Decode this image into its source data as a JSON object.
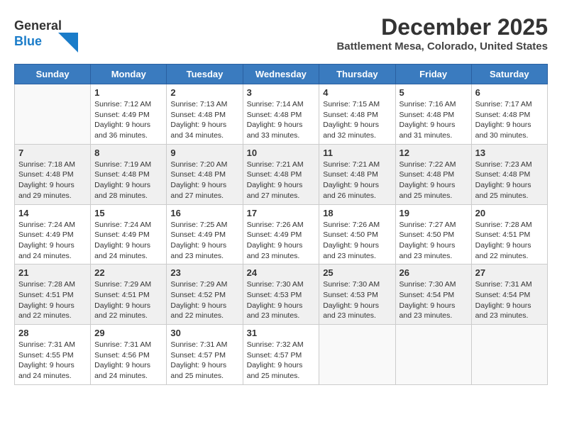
{
  "header": {
    "logo_general": "General",
    "logo_blue": "Blue",
    "month_title": "December 2025",
    "location": "Battlement Mesa, Colorado, United States"
  },
  "weekdays": [
    "Sunday",
    "Monday",
    "Tuesday",
    "Wednesday",
    "Thursday",
    "Friday",
    "Saturday"
  ],
  "weeks": [
    [
      {
        "day": "",
        "info": ""
      },
      {
        "day": "1",
        "info": "Sunrise: 7:12 AM\nSunset: 4:49 PM\nDaylight: 9 hours\nand 36 minutes."
      },
      {
        "day": "2",
        "info": "Sunrise: 7:13 AM\nSunset: 4:48 PM\nDaylight: 9 hours\nand 34 minutes."
      },
      {
        "day": "3",
        "info": "Sunrise: 7:14 AM\nSunset: 4:48 PM\nDaylight: 9 hours\nand 33 minutes."
      },
      {
        "day": "4",
        "info": "Sunrise: 7:15 AM\nSunset: 4:48 PM\nDaylight: 9 hours\nand 32 minutes."
      },
      {
        "day": "5",
        "info": "Sunrise: 7:16 AM\nSunset: 4:48 PM\nDaylight: 9 hours\nand 31 minutes."
      },
      {
        "day": "6",
        "info": "Sunrise: 7:17 AM\nSunset: 4:48 PM\nDaylight: 9 hours\nand 30 minutes."
      }
    ],
    [
      {
        "day": "7",
        "info": "Sunrise: 7:18 AM\nSunset: 4:48 PM\nDaylight: 9 hours\nand 29 minutes."
      },
      {
        "day": "8",
        "info": "Sunrise: 7:19 AM\nSunset: 4:48 PM\nDaylight: 9 hours\nand 28 minutes."
      },
      {
        "day": "9",
        "info": "Sunrise: 7:20 AM\nSunset: 4:48 PM\nDaylight: 9 hours\nand 27 minutes."
      },
      {
        "day": "10",
        "info": "Sunrise: 7:21 AM\nSunset: 4:48 PM\nDaylight: 9 hours\nand 27 minutes."
      },
      {
        "day": "11",
        "info": "Sunrise: 7:21 AM\nSunset: 4:48 PM\nDaylight: 9 hours\nand 26 minutes."
      },
      {
        "day": "12",
        "info": "Sunrise: 7:22 AM\nSunset: 4:48 PM\nDaylight: 9 hours\nand 25 minutes."
      },
      {
        "day": "13",
        "info": "Sunrise: 7:23 AM\nSunset: 4:48 PM\nDaylight: 9 hours\nand 25 minutes."
      }
    ],
    [
      {
        "day": "14",
        "info": "Sunrise: 7:24 AM\nSunset: 4:49 PM\nDaylight: 9 hours\nand 24 minutes."
      },
      {
        "day": "15",
        "info": "Sunrise: 7:24 AM\nSunset: 4:49 PM\nDaylight: 9 hours\nand 24 minutes."
      },
      {
        "day": "16",
        "info": "Sunrise: 7:25 AM\nSunset: 4:49 PM\nDaylight: 9 hours\nand 23 minutes."
      },
      {
        "day": "17",
        "info": "Sunrise: 7:26 AM\nSunset: 4:49 PM\nDaylight: 9 hours\nand 23 minutes."
      },
      {
        "day": "18",
        "info": "Sunrise: 7:26 AM\nSunset: 4:50 PM\nDaylight: 9 hours\nand 23 minutes."
      },
      {
        "day": "19",
        "info": "Sunrise: 7:27 AM\nSunset: 4:50 PM\nDaylight: 9 hours\nand 23 minutes."
      },
      {
        "day": "20",
        "info": "Sunrise: 7:28 AM\nSunset: 4:51 PM\nDaylight: 9 hours\nand 22 minutes."
      }
    ],
    [
      {
        "day": "21",
        "info": "Sunrise: 7:28 AM\nSunset: 4:51 PM\nDaylight: 9 hours\nand 22 minutes."
      },
      {
        "day": "22",
        "info": "Sunrise: 7:29 AM\nSunset: 4:51 PM\nDaylight: 9 hours\nand 22 minutes."
      },
      {
        "day": "23",
        "info": "Sunrise: 7:29 AM\nSunset: 4:52 PM\nDaylight: 9 hours\nand 22 minutes."
      },
      {
        "day": "24",
        "info": "Sunrise: 7:30 AM\nSunset: 4:53 PM\nDaylight: 9 hours\nand 23 minutes."
      },
      {
        "day": "25",
        "info": "Sunrise: 7:30 AM\nSunset: 4:53 PM\nDaylight: 9 hours\nand 23 minutes."
      },
      {
        "day": "26",
        "info": "Sunrise: 7:30 AM\nSunset: 4:54 PM\nDaylight: 9 hours\nand 23 minutes."
      },
      {
        "day": "27",
        "info": "Sunrise: 7:31 AM\nSunset: 4:54 PM\nDaylight: 9 hours\nand 23 minutes."
      }
    ],
    [
      {
        "day": "28",
        "info": "Sunrise: 7:31 AM\nSunset: 4:55 PM\nDaylight: 9 hours\nand 24 minutes."
      },
      {
        "day": "29",
        "info": "Sunrise: 7:31 AM\nSunset: 4:56 PM\nDaylight: 9 hours\nand 24 minutes."
      },
      {
        "day": "30",
        "info": "Sunrise: 7:31 AM\nSunset: 4:57 PM\nDaylight: 9 hours\nand 25 minutes."
      },
      {
        "day": "31",
        "info": "Sunrise: 7:32 AM\nSunset: 4:57 PM\nDaylight: 9 hours\nand 25 minutes."
      },
      {
        "day": "",
        "info": ""
      },
      {
        "day": "",
        "info": ""
      },
      {
        "day": "",
        "info": ""
      }
    ]
  ]
}
